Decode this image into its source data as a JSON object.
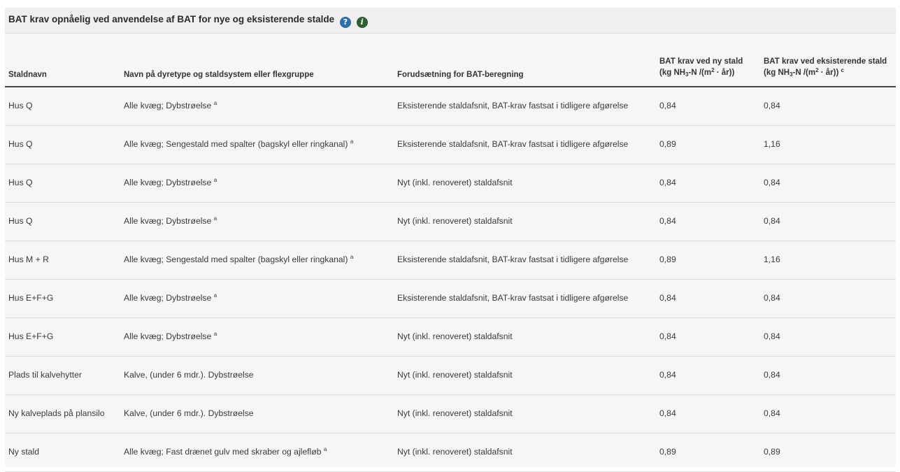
{
  "panel": {
    "title": "BAT krav opnåelig ved anvendelse af BAT for nye og eksisterende stalde",
    "icons": [
      "help-icon",
      "info-icon"
    ],
    "help_icon_glyph": "?",
    "info_icon_glyph": "i"
  },
  "table": {
    "headers": {
      "staldnavn": "Staldnavn",
      "dyretype": "Navn på dyretype og staldsystem eller flexgruppe",
      "forudsaetning": "Forudsætning for BAT-beregning",
      "ny_line1": "BAT krav ved ny stald",
      "ny_line2_pre": "(kg NH",
      "ny_line2_sub": "3",
      "ny_line2_mid": "-N /(m",
      "ny_line2_sup": "2",
      "ny_line2_post": " · år))",
      "eks_line1": "BAT krav ved eksisterende stald",
      "eks_line2_pre": "(kg NH",
      "eks_line2_sub": "3",
      "eks_line2_mid": "-N /(m",
      "eks_line2_sup": "2",
      "eks_line2_post": " · år))",
      "eks_footnote": "c"
    },
    "rows": [
      {
        "staldnavn": "Hus Q",
        "dyretype": "Alle kvæg; Dybstrøelse",
        "note": "a",
        "forudsaetning": "Eksisterende staldafsnit, BAT-krav fastsat i tidligere afgørelse",
        "ny": "0,84",
        "eks": "0,84"
      },
      {
        "staldnavn": "Hus Q",
        "dyretype": "Alle kvæg; Sengestald med spalter (bagskyl eller ringkanal)",
        "note": "a",
        "forudsaetning": "Eksisterende staldafsnit, BAT-krav fastsat i tidligere afgørelse",
        "ny": "0,89",
        "eks": "1,16"
      },
      {
        "staldnavn": "Hus Q",
        "dyretype": "Alle kvæg; Dybstrøelse",
        "note": "a",
        "forudsaetning": "Nyt (inkl. renoveret) staldafsnit",
        "ny": "0,84",
        "eks": "0,84"
      },
      {
        "staldnavn": "Hus Q",
        "dyretype": "Alle kvæg; Dybstrøelse",
        "note": "a",
        "forudsaetning": "Nyt (inkl. renoveret) staldafsnit",
        "ny": "0,84",
        "eks": "0,84"
      },
      {
        "staldnavn": "Hus M + R",
        "dyretype": "Alle kvæg; Sengestald med spalter (bagskyl eller ringkanal)",
        "note": "a",
        "forudsaetning": "Eksisterende staldafsnit, BAT-krav fastsat i tidligere afgørelse",
        "ny": "0,89",
        "eks": "1,16"
      },
      {
        "staldnavn": "Hus E+F+G",
        "dyretype": "Alle kvæg; Dybstrøelse",
        "note": "a",
        "forudsaetning": "Eksisterende staldafsnit, BAT-krav fastsat i tidligere afgørelse",
        "ny": "0,84",
        "eks": "0,84"
      },
      {
        "staldnavn": "Hus E+F+G",
        "dyretype": "Alle kvæg; Dybstrøelse",
        "note": "a",
        "forudsaetning": "Nyt (inkl. renoveret) staldafsnit",
        "ny": "0,84",
        "eks": "0,84"
      },
      {
        "staldnavn": "Plads til kalvehytter",
        "dyretype": "Kalve, (under 6 mdr.). Dybstrøelse",
        "note": "",
        "forudsaetning": "Nyt (inkl. renoveret) staldafsnit",
        "ny": "0,84",
        "eks": "0,84"
      },
      {
        "staldnavn": "Ny kalveplads på plansilo",
        "dyretype": "Kalve, (under 6 mdr.). Dybstrøelse",
        "note": "",
        "forudsaetning": "Nyt (inkl. renoveret) staldafsnit",
        "ny": "0,84",
        "eks": "0,84"
      },
      {
        "staldnavn": "Ny stald",
        "dyretype": "Alle kvæg; Fast drænet gulv med skraber og ajlefløb",
        "note": "a",
        "forudsaetning": "Nyt (inkl. renoveret) staldafsnit",
        "ny": "0,89",
        "eks": "0,89"
      }
    ]
  }
}
